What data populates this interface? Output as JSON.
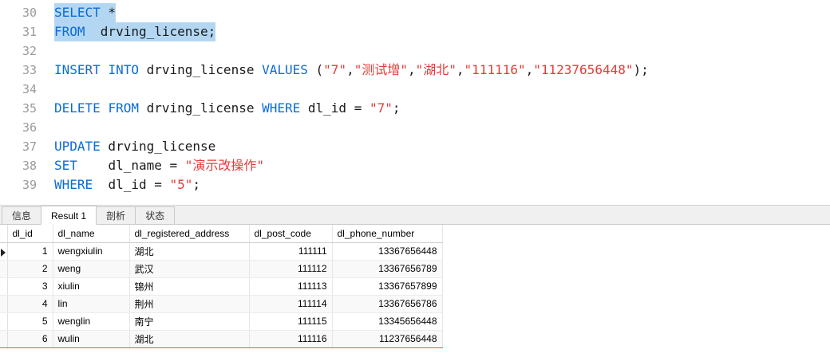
{
  "colors": {
    "keyword": "#0a6cd6",
    "string": "#e23c39",
    "selection": "#b3d7f3",
    "line_number": "#9b9b9b"
  },
  "editor": {
    "lines": [
      {
        "n": 30,
        "sel": true,
        "tokens": [
          [
            "kw",
            "SELECT"
          ],
          [
            "pl",
            " *"
          ]
        ]
      },
      {
        "n": 31,
        "sel": true,
        "tokens": [
          [
            "kw",
            "FROM"
          ],
          [
            "pl",
            "  drving_license;"
          ]
        ]
      },
      {
        "n": 32,
        "sel": false,
        "tokens": []
      },
      {
        "n": 33,
        "sel": false,
        "tokens": [
          [
            "kw",
            "INSERT"
          ],
          [
            "pl",
            " "
          ],
          [
            "kw",
            "INTO"
          ],
          [
            "pl",
            " drving_license "
          ],
          [
            "kw",
            "VALUES"
          ],
          [
            "pl",
            " ("
          ],
          [
            "str",
            "\"7\""
          ],
          [
            "pl",
            ","
          ],
          [
            "str",
            "\"测试增\""
          ],
          [
            "pl",
            ","
          ],
          [
            "str",
            "\"湖北\""
          ],
          [
            "pl",
            ","
          ],
          [
            "str",
            "\"111116\""
          ],
          [
            "pl",
            ","
          ],
          [
            "str",
            "\"11237656448\""
          ],
          [
            "pl",
            ");"
          ]
        ]
      },
      {
        "n": 34,
        "sel": false,
        "tokens": []
      },
      {
        "n": 35,
        "sel": false,
        "tokens": [
          [
            "kw",
            "DELETE"
          ],
          [
            "pl",
            " "
          ],
          [
            "kw",
            "FROM"
          ],
          [
            "pl",
            " drving_license "
          ],
          [
            "kw",
            "WHERE"
          ],
          [
            "pl",
            " dl_id = "
          ],
          [
            "str",
            "\"7\""
          ],
          [
            "pl",
            ";"
          ]
        ]
      },
      {
        "n": 36,
        "sel": false,
        "tokens": []
      },
      {
        "n": 37,
        "sel": false,
        "tokens": [
          [
            "kw",
            "UPDATE"
          ],
          [
            "pl",
            " drving_license"
          ]
        ]
      },
      {
        "n": 38,
        "sel": false,
        "tokens": [
          [
            "kw",
            "SET"
          ],
          [
            "pl",
            "    dl_name = "
          ],
          [
            "str",
            "\"演示改操作\""
          ]
        ]
      },
      {
        "n": 39,
        "sel": false,
        "tokens": [
          [
            "kw",
            "WHERE"
          ],
          [
            "pl",
            "  dl_id = "
          ],
          [
            "str",
            "\"5\""
          ],
          [
            "pl",
            ";"
          ]
        ]
      }
    ]
  },
  "tabs": [
    {
      "id": "info",
      "label": "信息",
      "active": false
    },
    {
      "id": "result-1",
      "label": "Result 1",
      "active": true
    },
    {
      "id": "profile",
      "label": "剖析",
      "active": false
    },
    {
      "id": "status",
      "label": "状态",
      "active": false
    }
  ],
  "table": {
    "columns": [
      "dl_id",
      "dl_name",
      "dl_registered_address",
      "dl_post_code",
      "dl_phone_number"
    ],
    "rows": [
      [
        "1",
        "wengxiulin",
        "湖北",
        "111111",
        "13367656448"
      ],
      [
        "2",
        "weng",
        "武汉",
        "111112",
        "13367656789"
      ],
      [
        "3",
        "xiulin",
        "锦州",
        "111113",
        "13367657899"
      ],
      [
        "4",
        "lin",
        "荆州",
        "111114",
        "13367656786"
      ],
      [
        "5",
        "wenglin",
        "南宁",
        "111115",
        "13345656448"
      ],
      [
        "6",
        "wulin",
        "湖北",
        "111116",
        "11237656448"
      ]
    ],
    "selected_row": 0
  }
}
